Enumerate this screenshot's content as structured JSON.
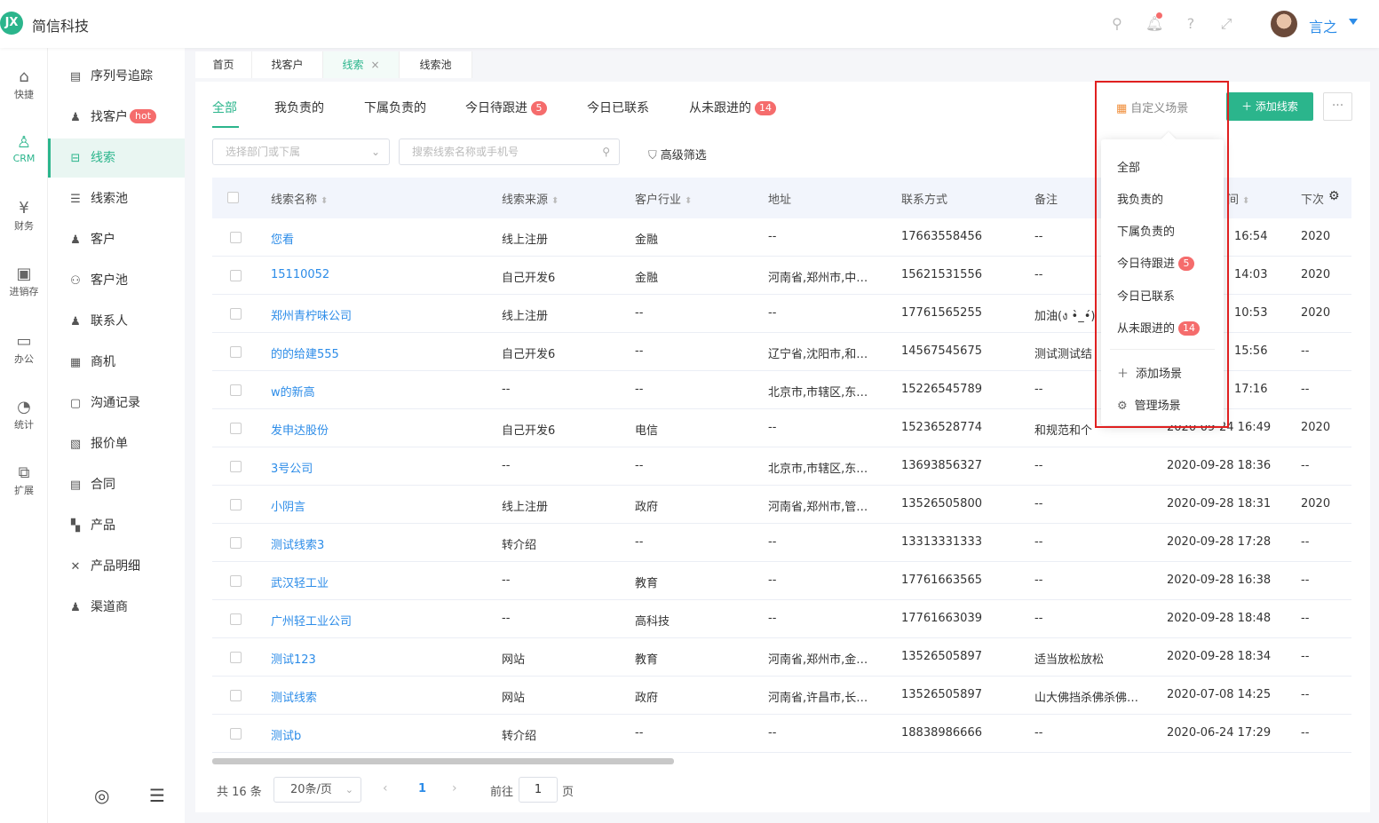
{
  "header": {
    "logo_text": "JX",
    "company": "简信科技",
    "username": "言之",
    "icons": [
      "search-icon",
      "bell-icon",
      "help-icon",
      "fullscreen-icon"
    ]
  },
  "rail": [
    {
      "label": "快捷",
      "icon": "home-icon"
    },
    {
      "label": "CRM",
      "icon": "user-icon"
    },
    {
      "label": "财务",
      "icon": "finance-icon"
    },
    {
      "label": "进销存",
      "icon": "store-icon"
    },
    {
      "label": "办公",
      "icon": "monitor-icon"
    },
    {
      "label": "统计",
      "icon": "stats-icon"
    },
    {
      "label": "扩展",
      "icon": "extend-icon"
    }
  ],
  "subnav": [
    {
      "label": "序列号追踪",
      "icon": "serial-icon"
    },
    {
      "label": "找客户",
      "icon": "find-customer-icon",
      "badge": "hot"
    },
    {
      "label": "线索",
      "icon": "leads-icon"
    },
    {
      "label": "线索池",
      "icon": "leads-pool-icon"
    },
    {
      "label": "客户",
      "icon": "customer-icon"
    },
    {
      "label": "客户池",
      "icon": "customer-pool-icon"
    },
    {
      "label": "联系人",
      "icon": "contact-icon"
    },
    {
      "label": "商机",
      "icon": "opportunity-icon"
    },
    {
      "label": "沟通记录",
      "icon": "record-icon"
    },
    {
      "label": "报价单",
      "icon": "quote-icon"
    },
    {
      "label": "合同",
      "icon": "contract-icon"
    },
    {
      "label": "产品",
      "icon": "product-icon"
    },
    {
      "label": "产品明细",
      "icon": "product-detail-icon"
    },
    {
      "label": "渠道商",
      "icon": "channel-icon"
    }
  ],
  "pagetabs": [
    {
      "label": "首页"
    },
    {
      "label": "找客户"
    },
    {
      "label": "线索",
      "close": "×"
    },
    {
      "label": "线索池"
    }
  ],
  "scenes": [
    {
      "label": "全部"
    },
    {
      "label": "我负责的"
    },
    {
      "label": "下属负责的"
    },
    {
      "label": "今日待跟进",
      "badge": "5"
    },
    {
      "label": "今日已联系"
    },
    {
      "label": "从未跟进的",
      "badge": "14"
    }
  ],
  "toolbar": {
    "custom_scene": "自定义场景",
    "add_lead": "添加线索",
    "more": "···"
  },
  "filters": {
    "dept_placeholder": "选择部门或下属",
    "search_placeholder": "搜索线索名称或手机号",
    "advanced": "高级筛选"
  },
  "table": {
    "columns": [
      "线索名称",
      "线索来源",
      "客户行业",
      "地址",
      "联系方式",
      "备注",
      "间",
      "下次"
    ],
    "rows": [
      [
        "您看",
        "线上注册",
        "金融",
        "--",
        "17663558456",
        "--",
        "16:54",
        "2020"
      ],
      [
        "15110052",
        "自己开发6",
        "金融",
        "河南省,郑州市,中…",
        "15621531556",
        "--",
        "14:03",
        "2020"
      ],
      [
        "郑州青柠味公司",
        "线上注册",
        "--",
        "--",
        "17761565255",
        "加油(ง •̀_•́)",
        "10:53",
        "2020"
      ],
      [
        "的的给建555",
        "自己开发6",
        "--",
        "辽宁省,沈阳市,和…",
        "14567545675",
        "测试测试结",
        "15:56",
        "--"
      ],
      [
        "w的新高",
        "--",
        "--",
        "北京市,市辖区,东…",
        "15226545789",
        "--",
        "17:16",
        "--"
      ],
      [
        "发申达股份",
        "自己开发6",
        "电信",
        "--",
        "15236528774",
        "和规范和个",
        "2020-09-24 16:49",
        "2020"
      ],
      [
        "3号公司",
        "--",
        "--",
        "北京市,市辖区,东…",
        "13693856327",
        "--",
        "2020-09-28 18:36",
        "--"
      ],
      [
        "小阴言",
        "线上注册",
        "政府",
        "河南省,郑州市,管…",
        "13526505800",
        "--",
        "2020-09-28 18:31",
        "2020"
      ],
      [
        "测试线索3",
        "转介绍",
        "--",
        "--",
        "13313331333",
        "--",
        "2020-09-28 17:28",
        "--"
      ],
      [
        "武汉轻工业",
        "--",
        "教育",
        "--",
        "17761663565",
        "--",
        "2020-09-28 16:38",
        "--"
      ],
      [
        "广州轻工业公司",
        "--",
        "高科技",
        "--",
        "17761663039",
        "--",
        "2020-09-28 18:48",
        "--"
      ],
      [
        "测试123",
        "网站",
        "教育",
        "河南省,郑州市,金…",
        "13526505897",
        "适当放松放松",
        "2020-09-28 18:34",
        "--"
      ],
      [
        "测试线索",
        "网站",
        "政府",
        "河南省,许昌市,长…",
        "13526505897",
        "山大佛挡杀佛杀佛…",
        "2020-07-08 14:25",
        "--"
      ],
      [
        "测试b",
        "转介绍",
        "--",
        "--",
        "18838986666",
        "--",
        "2020-06-24 17:29",
        "--"
      ]
    ]
  },
  "pagination": {
    "total": "共 16 条",
    "page_size": "20条/页",
    "current": "1",
    "goto_label": "前往",
    "goto_value": "1",
    "page_label": "页"
  },
  "dropdown": {
    "items": [
      {
        "label": "全部"
      },
      {
        "label": "我负责的"
      },
      {
        "label": "下属负责的"
      },
      {
        "label": "今日待跟进",
        "badge": "5"
      },
      {
        "label": "今日已联系"
      },
      {
        "label": "从未跟进的",
        "badge": "14"
      }
    ],
    "add_scene": "添加场景",
    "manage_scene": "管理场景"
  },
  "colors": {
    "accent": "#2bb58c",
    "link": "#2c8ce8",
    "badge": "#f56c6c",
    "highlight": "#e02020"
  }
}
